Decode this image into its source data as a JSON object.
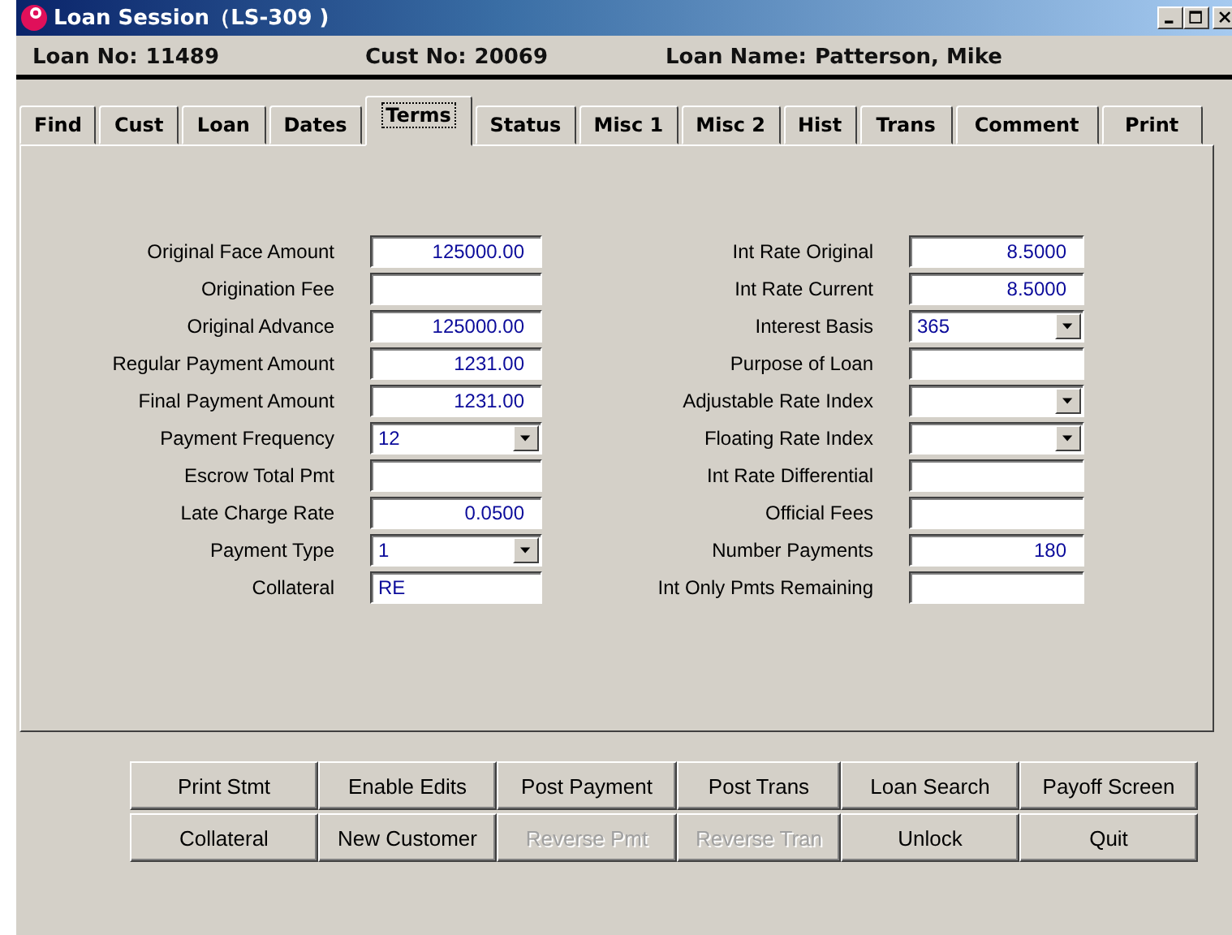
{
  "window": {
    "title": "Loan Session（LS-309 )"
  },
  "header": [
    {
      "label": "Loan No:",
      "value": "11489"
    },
    {
      "label": "Cust No:",
      "value": "20069"
    },
    {
      "label": "Loan Name:",
      "value": "Patterson, Mike"
    }
  ],
  "tabs": [
    {
      "label": "Find",
      "selected": false
    },
    {
      "label": "Cust",
      "selected": false
    },
    {
      "label": "Loan",
      "selected": false
    },
    {
      "label": "Dates",
      "selected": false
    },
    {
      "label": "Terms",
      "selected": true
    },
    {
      "label": "Status",
      "selected": false
    },
    {
      "label": "Misc 1",
      "selected": false
    },
    {
      "label": "Misc 2",
      "selected": false
    },
    {
      "label": "Hist",
      "selected": false
    },
    {
      "label": "Trans",
      "selected": false
    },
    {
      "label": "Comment",
      "selected": false
    },
    {
      "label": "Print",
      "selected": false
    }
  ],
  "left_fields": [
    {
      "label": "Original Face Amount",
      "kind": "number",
      "value": "125000.00"
    },
    {
      "label": "Origination Fee",
      "kind": "number"
    },
    {
      "label": "Original Advance",
      "kind": "number",
      "value": "125000.00"
    },
    {
      "label": "Regular Payment Amount",
      "kind": "number",
      "value": "1231.00"
    },
    {
      "label": "Final Payment Amount",
      "kind": "number",
      "value": "1231.00"
    },
    {
      "label": "Payment Frequency",
      "kind": "select",
      "value": "12"
    },
    {
      "label": "Escrow Total Pmt",
      "kind": "number"
    },
    {
      "label": "Late Charge Rate",
      "kind": "number",
      "value": "0.0500"
    },
    {
      "label": "Payment Type",
      "kind": "select",
      "value": "1"
    },
    {
      "label": "Collateral",
      "kind": "text",
      "value": "RE"
    }
  ],
  "right_fields": [
    {
      "label": "Int Rate Original",
      "kind": "number",
      "value": "8.5000"
    },
    {
      "label": "Int Rate Current",
      "kind": "number",
      "value": "8.5000"
    },
    {
      "label": "Interest Basis",
      "kind": "select",
      "value": "365"
    },
    {
      "label": "Purpose of Loan",
      "kind": "text"
    },
    {
      "label": "Adjustable Rate Index",
      "kind": "select"
    },
    {
      "label": "Floating Rate Index",
      "kind": "select"
    },
    {
      "label": "Int Rate Differential",
      "kind": "number"
    },
    {
      "label": "Official Fees",
      "kind": "number"
    },
    {
      "label": "Number Payments",
      "kind": "number",
      "value": "180"
    },
    {
      "label": "Int Only Pmts Remaining",
      "kind": "number"
    }
  ],
  "buttons": [
    {
      "label": "Print Stmt",
      "disabled": false
    },
    {
      "label": "Enable Edits",
      "disabled": false
    },
    {
      "label": "Post Payment",
      "disabled": false
    },
    {
      "label": "Post Trans",
      "disabled": false
    },
    {
      "label": "Loan Search",
      "disabled": false
    },
    {
      "label": "Payoff Screen",
      "disabled": false
    },
    {
      "label": "Collateral",
      "disabled": false
    },
    {
      "label": "New Customer",
      "disabled": false
    },
    {
      "label": "Reverse Pmt",
      "disabled": true
    },
    {
      "label": "Reverse Tran",
      "disabled": true
    },
    {
      "label": "Unlock",
      "disabled": false
    },
    {
      "label": "Quit",
      "disabled": false
    }
  ]
}
